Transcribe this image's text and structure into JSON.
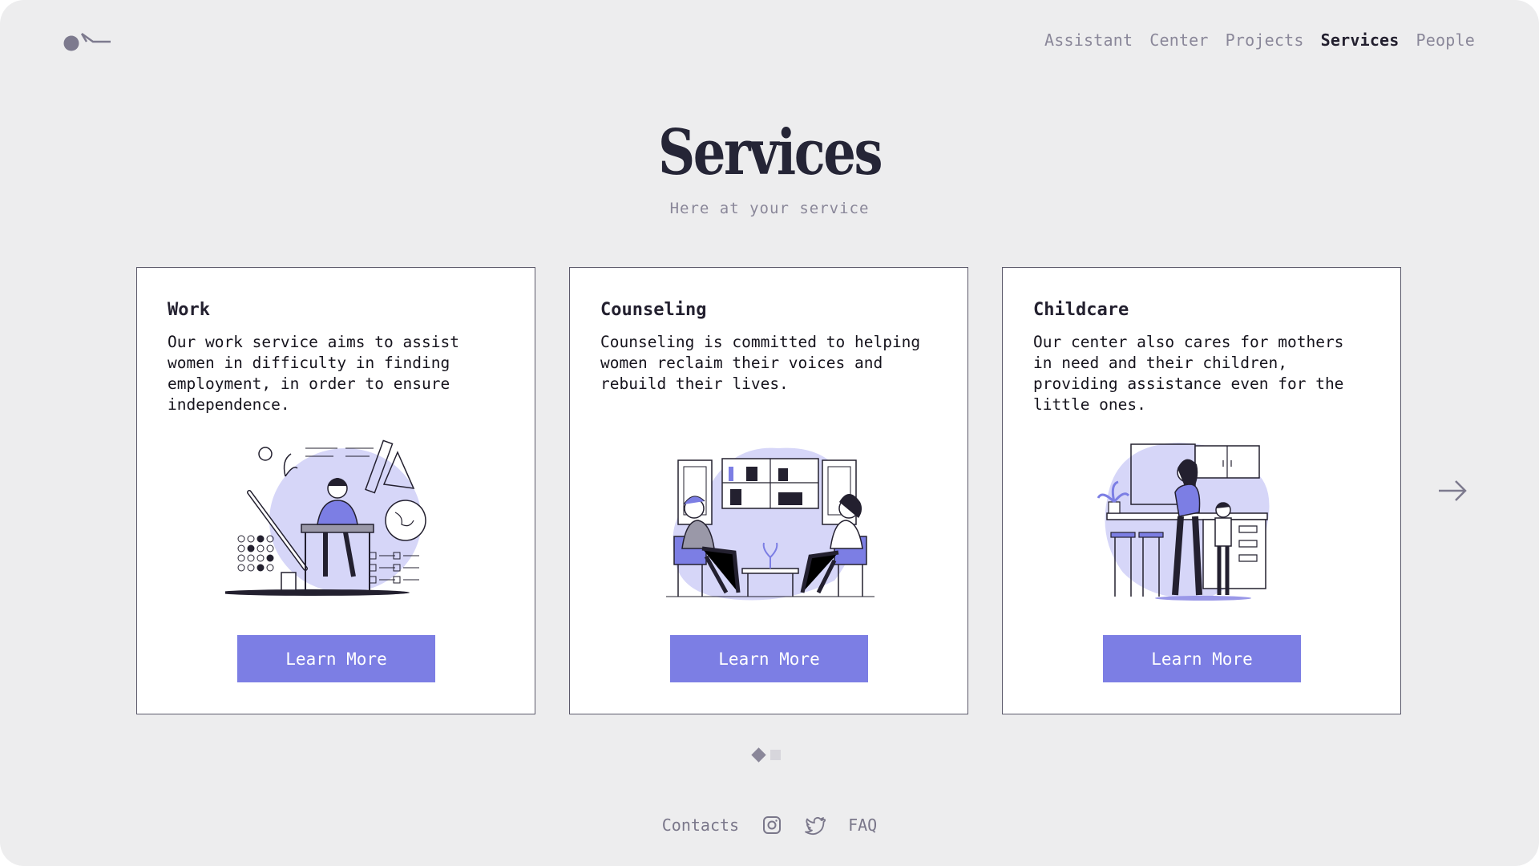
{
  "nav": {
    "items": [
      {
        "label": "Assistant",
        "active": false
      },
      {
        "label": "Center",
        "active": false
      },
      {
        "label": "Projects",
        "active": false
      },
      {
        "label": "Services",
        "active": true
      },
      {
        "label": "People",
        "active": false
      }
    ]
  },
  "header": {
    "title": "Services",
    "subtitle": "Here at your service"
  },
  "cards": [
    {
      "title": "Work",
      "text": "Our work service aims to assist\nwomen in difficulty in finding\nemployment, in order to ensure\nindependence.",
      "button": "Learn More",
      "illustration": "woman-studying-illustration"
    },
    {
      "title": "Counseling",
      "text": "Counseling is committed to helping\nwomen reclaim their voices and\nrebuild their lives.",
      "button": "Learn More",
      "illustration": "counseling-session-illustration"
    },
    {
      "title": "Childcare",
      "text": "Our center also cares for mothers\nin need and their children,\nproviding assistance even for the\nlittle ones.",
      "button": "Learn More",
      "illustration": "mother-and-child-kitchen-illustration"
    }
  ],
  "carousel": {
    "pages": 2,
    "current": 1,
    "next_icon": "arrow-right-icon"
  },
  "footer": {
    "contacts": "Contacts",
    "instagram_icon": "instagram-icon",
    "twitter_icon": "twitter-icon",
    "faq": "FAQ"
  },
  "colors": {
    "background": "#ededee",
    "accent": "#7c7ee4",
    "illustration_blob": "#d6d6f8",
    "text_dark": "#23202f",
    "text_muted": "#8a8799"
  }
}
